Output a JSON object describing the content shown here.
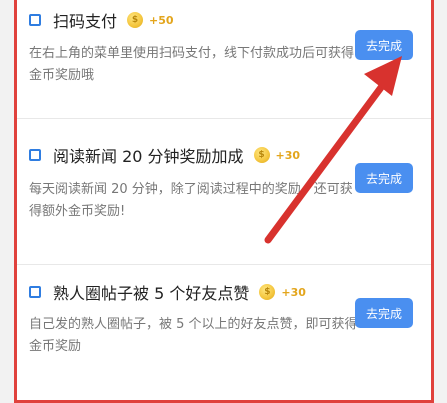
{
  "tasks": [
    {
      "title": "扫码支付",
      "points": "+50",
      "desc": "在右上角的菜单里使用扫码支付，线下付款成功后可获得金币奖励哦",
      "button_label": "去完成"
    },
    {
      "title": "阅读新闻 20 分钟奖励加成",
      "points": "+30",
      "desc": "每天阅读新闻 20 分钟，除了阅读过程中的奖励，还可获得额外金币奖励!",
      "button_label": "去完成"
    },
    {
      "title": "熟人圈帖子被 5 个好友点赞",
      "points": "+30",
      "desc": "自己发的熟人圈帖子，被 5 个以上的好友点赞，即可获得金币奖励",
      "button_label": "去完成"
    }
  ],
  "colors": {
    "accent_button": "#4a8ff0",
    "highlight_border": "#e0413c",
    "arrow": "#d8322e",
    "coin": "#f5c842",
    "points_text": "#e3a51c"
  },
  "icons": {
    "checkbox": "checkbox-icon",
    "coin": "coin-icon",
    "annotation": "red-arrow-icon"
  }
}
